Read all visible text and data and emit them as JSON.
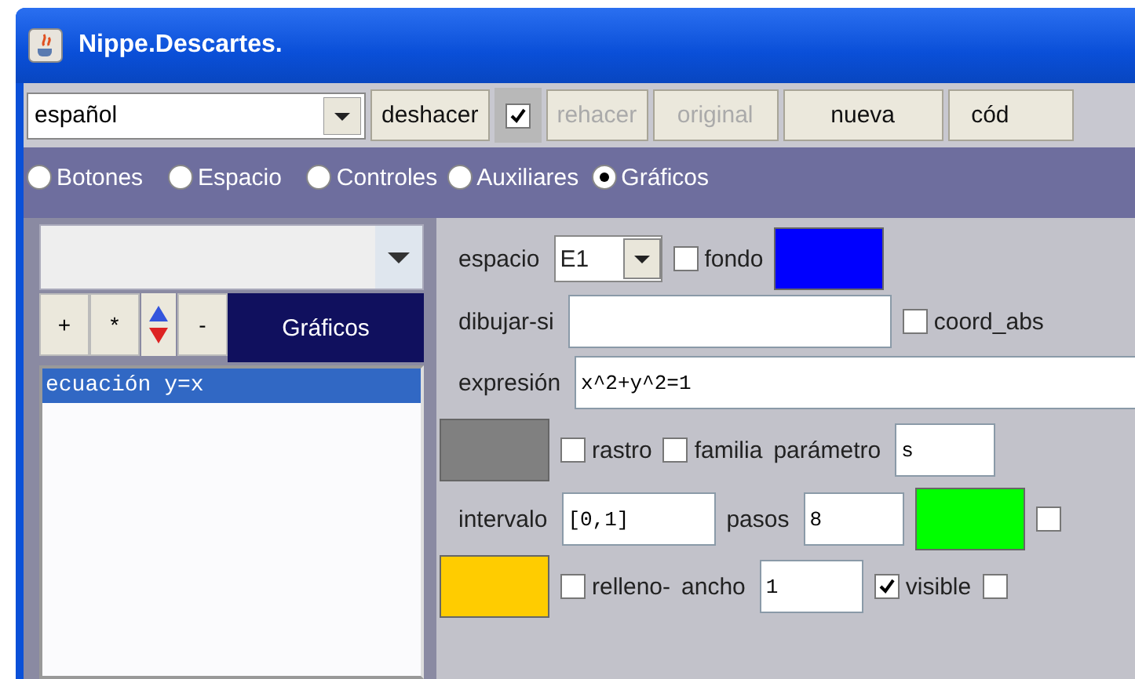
{
  "window": {
    "title": "Nippe.Descartes."
  },
  "toolbar": {
    "language": "español",
    "items": [
      {
        "kind": "button",
        "label": "deshacer",
        "disabled": false
      },
      {
        "kind": "checkbox",
        "checked": true
      },
      {
        "kind": "button",
        "label": "rehacer",
        "disabled": true
      },
      {
        "kind": "button",
        "label": "original",
        "disabled": true
      },
      {
        "kind": "button",
        "label": "nueva",
        "disabled": false
      },
      {
        "kind": "button",
        "label": "cód",
        "disabled": false
      }
    ]
  },
  "tabs": [
    {
      "label": "Botones",
      "selected": false
    },
    {
      "label": "Espacio",
      "selected": false
    },
    {
      "label": "Controles",
      "selected": false
    },
    {
      "label": "Auxiliares",
      "selected": false
    },
    {
      "label": "Gráficos",
      "selected": true
    }
  ],
  "sidebar": {
    "buttons": [
      "+",
      "*",
      "-"
    ],
    "title": "Gráficos",
    "items": [
      {
        "text": "ecuación y=x",
        "selected": true
      }
    ]
  },
  "form": [
    [
      {
        "kind": "label",
        "text": "espacio"
      },
      {
        "kind": "select",
        "value": "E1"
      },
      {
        "kind": "checkbox",
        "label": "fondo",
        "checked": false
      },
      {
        "kind": "color",
        "color": "#0000ff"
      }
    ],
    [
      {
        "kind": "label",
        "text": "dibujar-si"
      },
      {
        "kind": "field"
      },
      {
        "kind": "checkbox",
        "label": "coord_abs",
        "checked": false
      }
    ],
    [
      {
        "kind": "label",
        "text": "expresión"
      },
      {
        "kind": "field",
        "value": "x^2+y^2=1"
      }
    ],
    [
      {
        "kind": "color",
        "color": "#808080"
      },
      {
        "kind": "checkbox",
        "label": "rastro",
        "checked": false
      },
      {
        "kind": "checkbox",
        "label": "familia",
        "checked": false
      },
      {
        "kind": "label",
        "text": "parámetro"
      },
      {
        "kind": "field",
        "value": "s"
      }
    ],
    [
      {
        "kind": "label",
        "text": "intervalo"
      },
      {
        "kind": "field",
        "value": "[0,1]"
      },
      {
        "kind": "label",
        "text": "pasos"
      },
      {
        "kind": "field",
        "value": "8"
      },
      {
        "kind": "color",
        "color": "#00ff00"
      },
      {
        "kind": "checkbox",
        "checked": false
      }
    ],
    [
      {
        "kind": "color",
        "color": "#ffcc00"
      },
      {
        "kind": "checkbox",
        "label": "relleno-",
        "checked": false
      },
      {
        "kind": "label",
        "text": "ancho"
      },
      {
        "kind": "field",
        "value": "1"
      },
      {
        "kind": "checkbox",
        "label": "visible",
        "checked": true
      },
      {
        "kind": "checkbox",
        "checked": false
      }
    ]
  ]
}
